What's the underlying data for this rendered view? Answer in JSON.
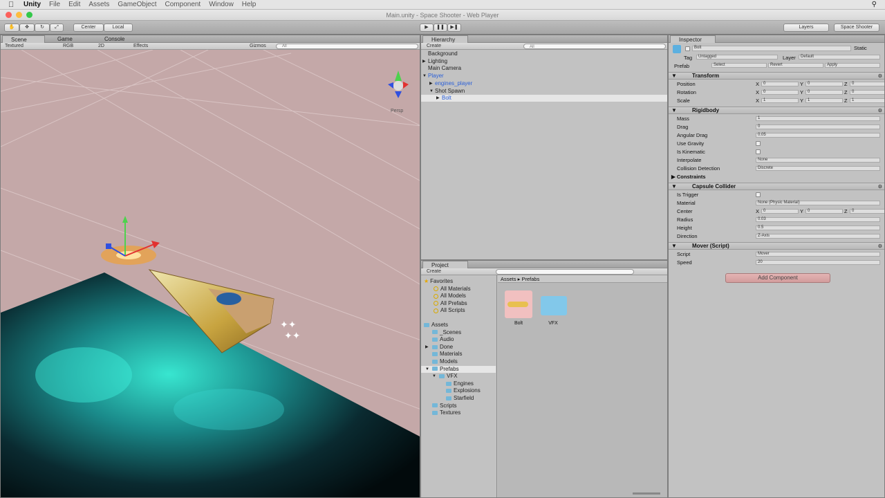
{
  "menubar": {
    "app": "Unity",
    "items": [
      "File",
      "Edit",
      "Assets",
      "GameObject",
      "Component",
      "Window",
      "Help"
    ]
  },
  "window_title": "Main.unity - Space Shooter - Web Player",
  "toolbar": {
    "pivot": "Center",
    "space": "Local",
    "layers": "Layers",
    "layout": "Space Shooter"
  },
  "scene": {
    "tabs": [
      "Scene",
      "Game",
      "Console"
    ],
    "shading": "Textured",
    "render": "RGB",
    "mode_2d": "2D",
    "effects": "Effects",
    "gizmos": "Gizmos",
    "search": "All",
    "persp": "Persp"
  },
  "hierarchy": {
    "title": "Hierarchy",
    "create": "Create",
    "search": "All",
    "items": [
      {
        "label": "Background",
        "indent": 0,
        "selected": false,
        "blue": false
      },
      {
        "label": "Lighting",
        "indent": 0,
        "selected": false,
        "blue": false,
        "arrow": "▶"
      },
      {
        "label": "Main Camera",
        "indent": 0,
        "selected": false,
        "blue": false
      },
      {
        "label": "Player",
        "indent": 0,
        "selected": false,
        "blue": true,
        "arrow": "▼"
      },
      {
        "label": "engines_player",
        "indent": 1,
        "selected": false,
        "blue": true,
        "arrow": "▶"
      },
      {
        "label": "Shot Spawn",
        "indent": 1,
        "selected": false,
        "blue": false,
        "arrow": "▼"
      },
      {
        "label": "Bolt",
        "indent": 2,
        "selected": true,
        "blue": true,
        "arrow": "▶"
      }
    ]
  },
  "project": {
    "title": "Project",
    "create": "Create",
    "breadcrumb": [
      "Assets",
      "Prefabs"
    ],
    "favorites_label": "Favorites",
    "favorites": [
      "All Materials",
      "All Models",
      "All Prefabs",
      "All Scripts"
    ],
    "assets_label": "Assets",
    "folders": [
      {
        "label": "_Scenes",
        "indent": 1
      },
      {
        "label": "Audio",
        "indent": 1
      },
      {
        "label": "Done",
        "indent": 1,
        "arrow": "▶"
      },
      {
        "label": "Materials",
        "indent": 1
      },
      {
        "label": "Models",
        "indent": 1
      },
      {
        "label": "Prefabs",
        "indent": 1,
        "arrow": "▼",
        "selected": true
      },
      {
        "label": "VFX",
        "indent": 2,
        "arrow": "▼"
      },
      {
        "label": "Engines",
        "indent": 3
      },
      {
        "label": "Explosions",
        "indent": 3
      },
      {
        "label": "Starfield",
        "indent": 3
      },
      {
        "label": "Scripts",
        "indent": 1
      },
      {
        "label": "Textures",
        "indent": 1
      }
    ],
    "grid_items": [
      "Bolt",
      "VFX"
    ]
  },
  "inspector": {
    "title": "Inspector",
    "object_name": "Bolt",
    "static_label": "Static",
    "tag_label": "Tag",
    "tag_value": "Untagged",
    "layer_label": "Layer",
    "layer_value": "Default",
    "prefab_label": "Prefab",
    "prefab_buttons": [
      "Select",
      "Revert",
      "Apply"
    ],
    "transform": {
      "title": "Transform",
      "position": {
        "label": "Position",
        "x": "0",
        "y": "0",
        "z": "0"
      },
      "rotation": {
        "label": "Rotation",
        "x": "0",
        "y": "0",
        "z": "0"
      },
      "scale": {
        "label": "Scale",
        "x": "1",
        "y": "1",
        "z": "1"
      }
    },
    "rigidbody": {
      "title": "Rigidbody",
      "mass": {
        "label": "Mass",
        "value": "1"
      },
      "drag": {
        "label": "Drag",
        "value": "0"
      },
      "angular_drag": {
        "label": "Angular Drag",
        "value": "0.05"
      },
      "use_gravity": {
        "label": "Use Gravity"
      },
      "is_kinematic": {
        "label": "Is Kinematic"
      },
      "interpolate": {
        "label": "Interpolate",
        "value": "None"
      },
      "collision": {
        "label": "Collision Detection",
        "value": "Discrete"
      },
      "constraints": "Constraints"
    },
    "capsule": {
      "title": "Capsule Collider",
      "is_trigger": {
        "label": "Is Trigger"
      },
      "material": {
        "label": "Material",
        "value": "None (Physic Material)"
      },
      "center": {
        "label": "Center",
        "x": "0",
        "y": "0",
        "z": "0"
      },
      "radius": {
        "label": "Radius",
        "value": "0.03"
      },
      "height": {
        "label": "Height",
        "value": "0.5"
      },
      "direction": {
        "label": "Direction",
        "value": "Z-Axis"
      }
    },
    "mover": {
      "title": "Mover (Script)",
      "script": {
        "label": "Script",
        "value": "Mover"
      },
      "speed": {
        "label": "Speed",
        "value": "20"
      }
    },
    "add_component": "Add Component"
  }
}
